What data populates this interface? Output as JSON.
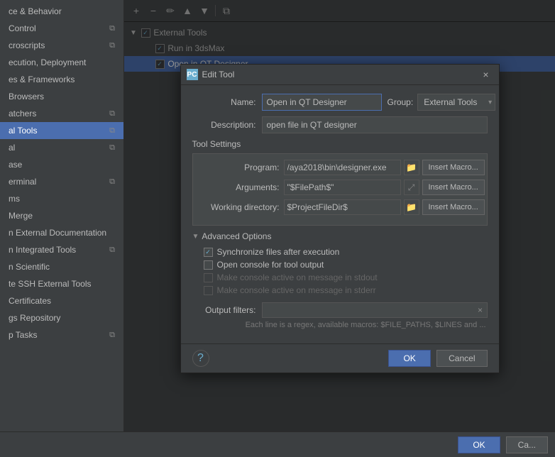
{
  "sidebar": {
    "items": [
      {
        "id": "appearance-behavior",
        "label": "ce & Behavior",
        "hasIcon": false,
        "active": false
      },
      {
        "id": "control",
        "label": "Control",
        "hasIcon": true,
        "active": false
      },
      {
        "id": "macroscripts",
        "label": "croscripts",
        "hasIcon": true,
        "active": false
      },
      {
        "id": "execution",
        "label": "ecution, Deployment",
        "hasIcon": false,
        "active": false
      },
      {
        "id": "es-frameworks",
        "label": "es & Frameworks",
        "hasIcon": false,
        "active": false
      },
      {
        "id": "browsers",
        "label": "Browsers",
        "hasIcon": false,
        "active": false
      },
      {
        "id": "watchers",
        "label": "atchers",
        "hasIcon": true,
        "active": false
      },
      {
        "id": "external-tools",
        "label": "al Tools",
        "hasIcon": true,
        "active": true
      },
      {
        "id": "internal",
        "label": "al",
        "hasIcon": true,
        "active": false
      },
      {
        "id": "database",
        "label": "ase",
        "hasIcon": false,
        "active": false
      },
      {
        "id": "terminal",
        "label": "erminal",
        "hasIcon": true,
        "active": false
      },
      {
        "id": "forms",
        "label": "ms",
        "hasIcon": false,
        "active": false
      },
      {
        "id": "merge",
        "label": "Merge",
        "hasIcon": false,
        "active": false
      },
      {
        "id": "open-external",
        "label": "n External Documentation",
        "hasIcon": false,
        "active": false
      },
      {
        "id": "integrated-tools",
        "label": "n Integrated Tools",
        "hasIcon": true,
        "active": false
      },
      {
        "id": "scientific",
        "label": "n Scientific",
        "hasIcon": false,
        "active": false
      },
      {
        "id": "ssh-external",
        "label": "te SSH External Tools",
        "hasIcon": false,
        "active": false
      },
      {
        "id": "certificates",
        "label": "Certificates",
        "hasIcon": false,
        "active": false
      },
      {
        "id": "repository",
        "label": "gs Repository",
        "hasIcon": false,
        "active": false
      },
      {
        "id": "tasks",
        "label": "p Tasks",
        "hasIcon": true,
        "active": false
      }
    ]
  },
  "toolbar": {
    "add_btn": "+",
    "remove_btn": "−",
    "edit_btn": "✏",
    "up_btn": "▲",
    "down_btn": "▼",
    "copy_btn": "⧉"
  },
  "tree": {
    "items": [
      {
        "id": "external-tools-group",
        "label": "External Tools",
        "level": 0,
        "arrow": "▼",
        "checked": true,
        "selected": false
      },
      {
        "id": "run-in-3dsmax",
        "label": "Run in 3dsMax",
        "level": 1,
        "arrow": "",
        "checked": true,
        "selected": false
      },
      {
        "id": "open-in-qt-designer",
        "label": "Open in QT Designer",
        "level": 1,
        "arrow": "",
        "checked": true,
        "selected": true
      }
    ]
  },
  "dialog": {
    "title": "Edit Tool",
    "title_icon": "PC",
    "close_label": "×",
    "name_label": "Name:",
    "name_value": "Open in QT Designer",
    "group_label": "Group:",
    "group_value": "External Tools",
    "group_options": [
      "External Tools"
    ],
    "description_label": "Description:",
    "description_value": "open file in QT designer",
    "tool_settings_label": "Tool Settings",
    "program_label": "Program:",
    "program_value": "/aya2018\\bin\\designer.exe",
    "program_btn": "📁",
    "program_macro_btn": "Insert Macro...",
    "arguments_label": "Arguments:",
    "arguments_value": "\"$FilePath$\"",
    "arguments_expand_btn": "⤢",
    "arguments_macro_btn": "Insert Macro...",
    "workdir_label": "Working directory:",
    "workdir_value": "$ProjectFileDir$",
    "workdir_btn": "📁",
    "workdir_macro_btn": "Insert Macro...",
    "advanced_label": "Advanced Options",
    "sync_files_label": "Synchronize files after execution",
    "sync_files_checked": true,
    "open_console_label": "Open console for tool output",
    "open_console_checked": false,
    "make_active_stdout_label": "Make console active on message in stdout",
    "make_active_stdout_checked": false,
    "make_active_stderr_label": "Make console active on message in stderr",
    "make_active_stderr_checked": false,
    "output_filters_label": "Output filters:",
    "output_filters_value": "",
    "output_filters_hint": "Each line is a regex, available macros: $FILE_PATHS, $LINES and ...",
    "output_clear_btn": "×",
    "help_btn": "?",
    "ok_btn": "OK",
    "cancel_btn": "Cancel"
  },
  "bottom_bar": {
    "ok_btn": "OK",
    "cancel_btn": "Ca..."
  }
}
